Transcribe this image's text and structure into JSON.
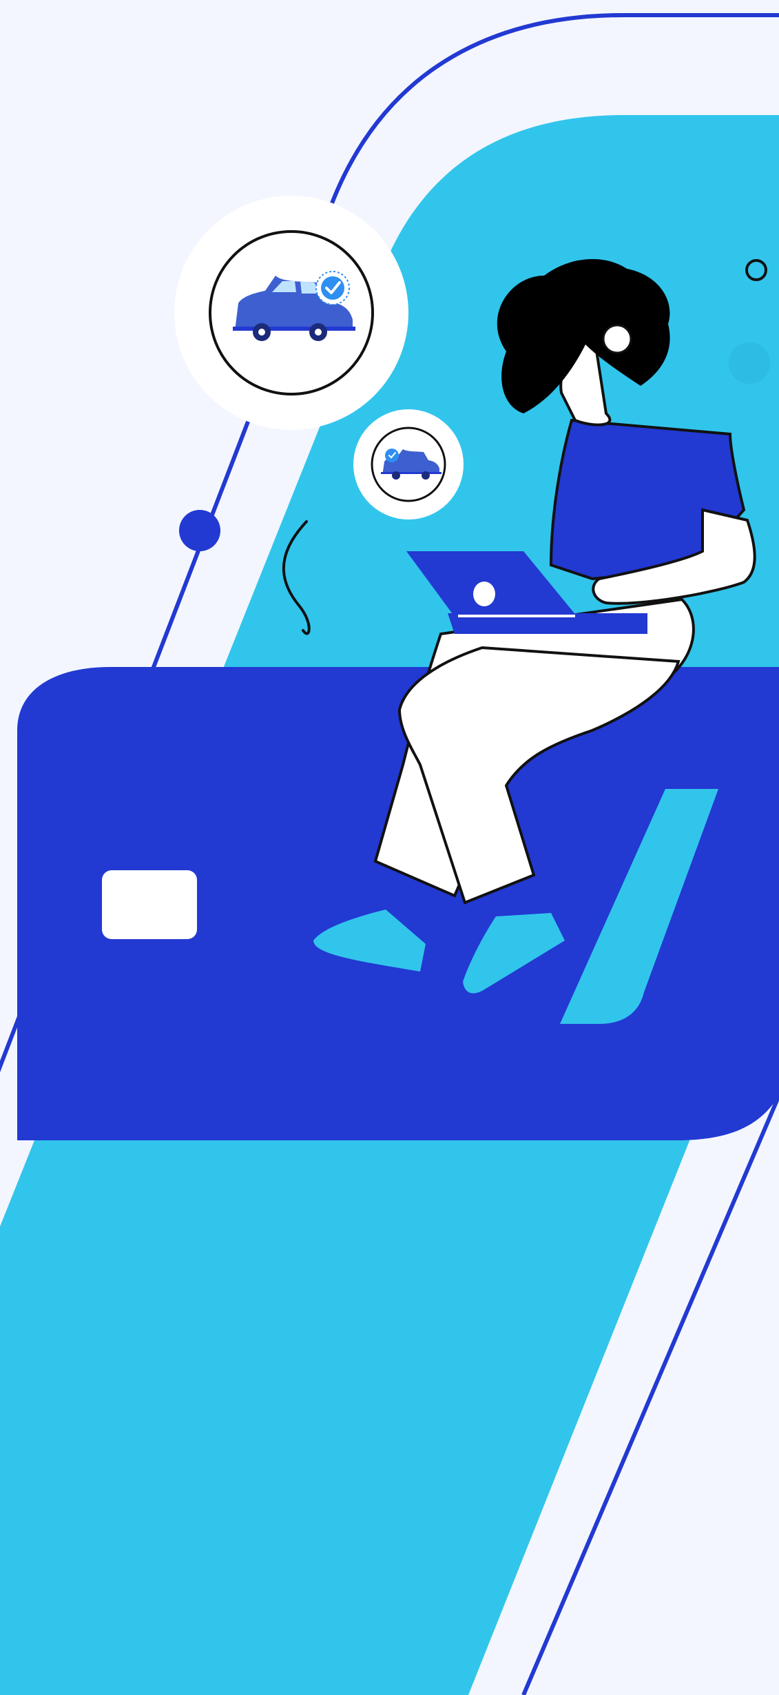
{
  "screen": {
    "name": "car-payment-illustration"
  },
  "colors": {
    "background": "#f3f6fe",
    "primary_blue": "#2239d2",
    "accent_cyan": "#31c5ec",
    "white": "#ffffff",
    "ink": "#000000",
    "car_blue": "#3e5fd0",
    "check_blue": "#2f8ff0"
  },
  "icons": {
    "large_badge": "car-check-icon",
    "small_badge": "car-check-icon-small"
  }
}
